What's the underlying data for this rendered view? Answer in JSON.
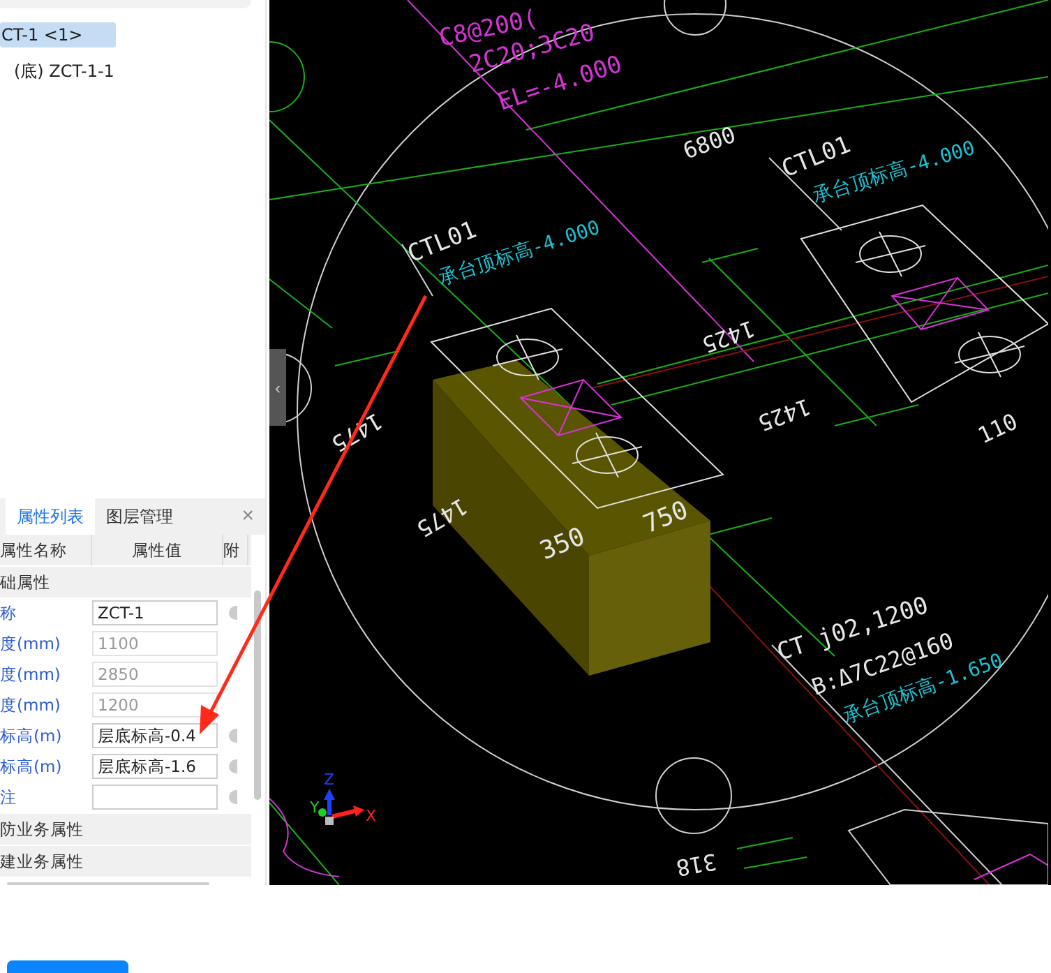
{
  "tree": {
    "items": [
      {
        "label": "CT-1 <1>",
        "selected": true,
        "children": [
          {
            "label": "(底) ZCT-1-1",
            "selected": false
          }
        ]
      }
    ]
  },
  "properties_panel": {
    "tabs": [
      {
        "label": "属性列表",
        "selected": true
      },
      {
        "label": "图层管理",
        "selected": false
      }
    ],
    "close": "×",
    "columns": [
      "属性名称",
      "属性值",
      "附"
    ],
    "rows": [
      {
        "kind": "group",
        "label": "础属性"
      },
      {
        "kind": "field",
        "label": "称",
        "value": "ZCT-1",
        "disabled": false
      },
      {
        "kind": "field",
        "label": "度(mm)",
        "value": "1100",
        "disabled": true
      },
      {
        "kind": "field",
        "label": "度(mm)",
        "value": "2850",
        "disabled": true
      },
      {
        "kind": "field",
        "label": "度(mm)",
        "value": "1200",
        "disabled": true
      },
      {
        "kind": "field",
        "label": "标高(m)",
        "value": "层底标高-0.4",
        "disabled": false
      },
      {
        "kind": "field",
        "label": "标高(m)",
        "value": "层底标高-1.6",
        "disabled": false
      },
      {
        "kind": "field",
        "label": "注",
        "disabled": false
      },
      {
        "kind": "group",
        "label": "防业务属性"
      },
      {
        "kind": "group",
        "label": "建业务属性"
      }
    ]
  },
  "cad_view": {
    "collapse_handle": "‹",
    "labels": [
      {
        "text": "C8@200(",
        "color": "#d633d6"
      },
      {
        "text": "2C20;3C20",
        "color": "#d633d6"
      },
      {
        "text": "EL=-4.000",
        "color": "#d633d6"
      },
      {
        "text": "6800",
        "color": "#e6e6e6"
      },
      {
        "text": "CTL01",
        "color": "#e6e6e6"
      },
      {
        "text": "承台顶标高-4.000",
        "color": "#19c3d2"
      },
      {
        "text": "CTL01",
        "color": "#e6e6e6"
      },
      {
        "text": "承台顶标高-4.000",
        "color": "#19c3d2"
      },
      {
        "text": "1425",
        "color": "#e6e6e6"
      },
      {
        "text": "1475",
        "color": "#e6e6e6"
      },
      {
        "text": "1425",
        "color": "#e6e6e6"
      },
      {
        "text": "110",
        "color": "#e6e6e6"
      },
      {
        "text": "1475",
        "color": "#e6e6e6"
      },
      {
        "text": "350",
        "color": "#e6e6e6"
      },
      {
        "text": "750",
        "color": "#e6e6e6"
      },
      {
        "text": "CT j02,1200",
        "color": "#e6e6e6"
      },
      {
        "text": "B:Δ7C22@160",
        "color": "#e6e6e6"
      },
      {
        "text": "承台顶标高-1.650",
        "color": "#19c3d2"
      },
      {
        "text": "318",
        "color": "#e6e6e6"
      }
    ],
    "axis_labels": [
      {
        "text": "Z",
        "color": "#2040ff"
      },
      {
        "text": "Y",
        "color": "#20d020"
      },
      {
        "text": "X",
        "color": "#ff2020"
      }
    ]
  }
}
